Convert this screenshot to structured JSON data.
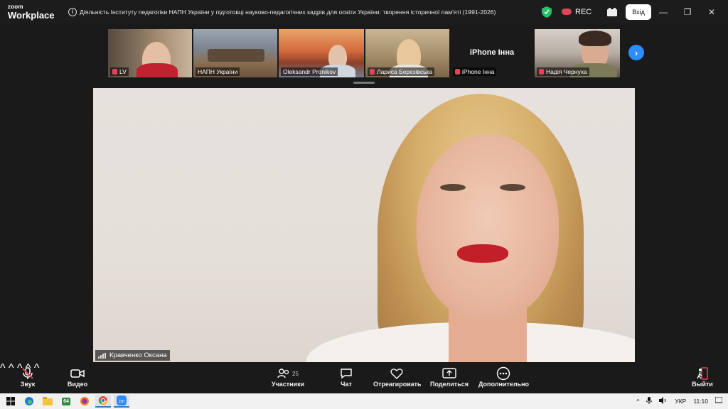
{
  "app": {
    "logo_line1": "zoom",
    "logo_line2": "Workplace",
    "meeting_title": "Діяльність Інституту педагогіки НАПН України у підготовці науково-педагогічних кадрів для освіти України: творення історичної пам'яті (1991-2026)",
    "rec_label": "REC",
    "login_label": "Вхід",
    "window_controls": [
      "—",
      "❐",
      "✕"
    ]
  },
  "participants_strip": [
    {
      "name": "LV",
      "muted": true
    },
    {
      "name": "НАПН України",
      "muted": false
    },
    {
      "name": "Oleksandr Pronikov",
      "muted": false
    },
    {
      "name": "Лариса Березівська",
      "muted": true
    },
    {
      "name": "iPhone Інна",
      "muted": true,
      "video_off": true,
      "center_label": "iPhone Інна"
    },
    {
      "name": "Надія Чернуха",
      "muted": true
    }
  ],
  "main_speaker": {
    "name": "Кравченко Оксана"
  },
  "toolbar": {
    "audio_label": "Звук",
    "video_label": "Видео",
    "participants_label": "Участники",
    "participants_count": "25",
    "chat_label": "Чат",
    "react_label": "Отреагировать",
    "share_label": "Поделиться",
    "more_label": "Дополнительно",
    "leave_label": "Выйти"
  },
  "taskbar": {
    "apps": [
      "windows-start",
      "edge",
      "file-explorer",
      "app-64",
      "firefox",
      "chrome",
      "zoom"
    ],
    "app_64_label": "64",
    "language": "УКР",
    "time": "11:10"
  },
  "colors": {
    "accent": "#2d8cff",
    "rec": "#e0445a",
    "shield": "#23c26b"
  }
}
